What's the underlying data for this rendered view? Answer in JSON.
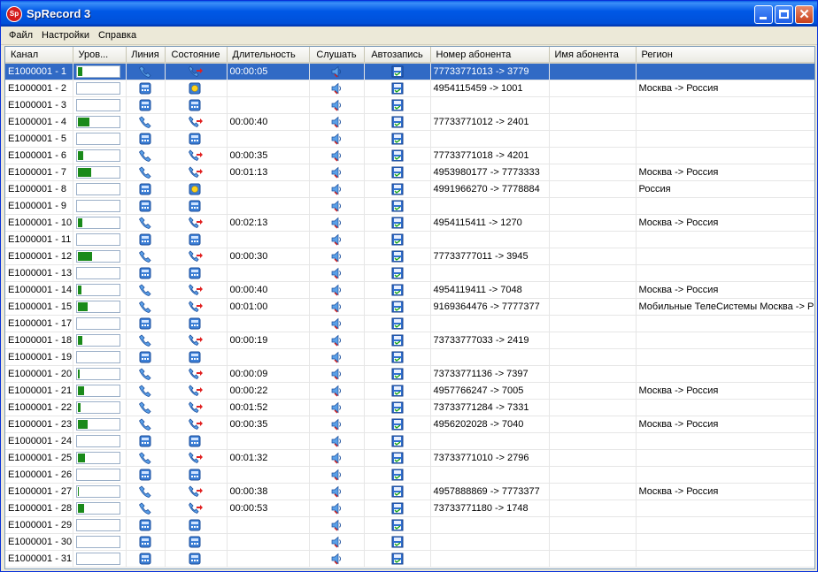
{
  "window": {
    "title": "SpRecord 3",
    "icon_label": "Sp"
  },
  "menu": [
    {
      "label": "Файл"
    },
    {
      "label": "Настройки"
    },
    {
      "label": "Справка"
    }
  ],
  "columns": [
    "Канал",
    "Уров...",
    "Линия",
    "Состояние",
    "Длительность",
    "Слушать",
    "Автозапись",
    "Номер абонента",
    "Имя абонента",
    "Регион"
  ],
  "icons": {
    "line_idle": "desk-phone-icon",
    "line_active": "handset-icon",
    "state_call": "handset-arrow-icon",
    "state_ring": "ringing-icon",
    "listen": "speaker-icon",
    "autorecord": "disk-record-icon"
  },
  "rows": [
    {
      "channel": "E1000001 - 1",
      "level": 0.12,
      "line": "active",
      "state": "call",
      "duration": "00:00:05",
      "number": "77733771013 -> 3779",
      "name": "",
      "region": ""
    },
    {
      "channel": "E1000001 - 2",
      "level": 0,
      "line": "idle",
      "state": "ring",
      "duration": "",
      "number": "4954115459 -> 1001",
      "name": "",
      "region": "Москва -> Россия"
    },
    {
      "channel": "E1000001 - 3",
      "level": 0,
      "line": "idle",
      "state": "idle",
      "duration": "",
      "number": "",
      "name": "",
      "region": ""
    },
    {
      "channel": "E1000001 - 4",
      "level": 0.28,
      "line": "active",
      "state": "call",
      "duration": "00:00:40",
      "number": "77733771012 -> 2401",
      "name": "",
      "region": ""
    },
    {
      "channel": "E1000001 - 5",
      "level": 0,
      "line": "idle",
      "state": "idle",
      "duration": "",
      "number": "",
      "name": "",
      "region": ""
    },
    {
      "channel": "E1000001 - 6",
      "level": 0.14,
      "line": "active",
      "state": "call",
      "duration": "00:00:35",
      "number": "77733771018 -> 4201",
      "name": "",
      "region": ""
    },
    {
      "channel": "E1000001 - 7",
      "level": 0.32,
      "line": "active",
      "state": "call",
      "duration": "00:01:13",
      "number": "4953980177 -> 7773333",
      "name": "",
      "region": "Москва -> Россия"
    },
    {
      "channel": "E1000001 - 8",
      "level": 0,
      "line": "idle",
      "state": "ring",
      "duration": "",
      "number": "4991966270 -> 7778884",
      "name": "",
      "region": "Россия"
    },
    {
      "channel": "E1000001 - 9",
      "level": 0,
      "line": "idle",
      "state": "idle",
      "duration": "",
      "number": "",
      "name": "",
      "region": ""
    },
    {
      "channel": "E1000001 - 10",
      "level": 0.12,
      "line": "active",
      "state": "call",
      "duration": "00:02:13",
      "number": "4954115411 -> 1270",
      "name": "",
      "region": "Москва -> Россия"
    },
    {
      "channel": "E1000001 - 11",
      "level": 0,
      "line": "idle",
      "state": "idle",
      "duration": "",
      "number": "",
      "name": "",
      "region": ""
    },
    {
      "channel": "E1000001 - 12",
      "level": 0.34,
      "line": "active",
      "state": "call",
      "duration": "00:00:30",
      "number": "77733777011 -> 3945",
      "name": "",
      "region": ""
    },
    {
      "channel": "E1000001 - 13",
      "level": 0,
      "line": "idle",
      "state": "idle",
      "duration": "",
      "number": "",
      "name": "",
      "region": ""
    },
    {
      "channel": "E1000001 - 14",
      "level": 0.1,
      "line": "active",
      "state": "call",
      "duration": "00:00:40",
      "number": "4954119411 -> 7048",
      "name": "",
      "region": "Москва -> Россия"
    },
    {
      "channel": "E1000001 - 15",
      "level": 0.24,
      "line": "active",
      "state": "call",
      "duration": "00:01:00",
      "number": "9169364476 -> 7777377",
      "name": "",
      "region": "Мобильные ТелеСистемы  Москва -> Р"
    },
    {
      "channel": "E1000001 - 17",
      "level": 0,
      "line": "idle",
      "state": "idle",
      "duration": "",
      "number": "",
      "name": "",
      "region": ""
    },
    {
      "channel": "E1000001 - 18",
      "level": 0.12,
      "line": "active",
      "state": "call",
      "duration": "00:00:19",
      "number": "73733777033 -> 2419",
      "name": "",
      "region": ""
    },
    {
      "channel": "E1000001 - 19",
      "level": 0,
      "line": "idle",
      "state": "idle",
      "duration": "",
      "number": "",
      "name": "",
      "region": ""
    },
    {
      "channel": "E1000001 - 20",
      "level": 0.05,
      "line": "active",
      "state": "call",
      "duration": "00:00:09",
      "number": "73733771136 -> 7397",
      "name": "",
      "region": ""
    },
    {
      "channel": "E1000001 - 21",
      "level": 0.16,
      "line": "active",
      "state": "call",
      "duration": "00:00:22",
      "number": "4957766247 -> 7005",
      "name": "",
      "region": "Москва -> Россия"
    },
    {
      "channel": "E1000001 - 22",
      "level": 0.08,
      "line": "active",
      "state": "call",
      "duration": "00:01:52",
      "number": "73733771284 -> 7331",
      "name": "",
      "region": ""
    },
    {
      "channel": "E1000001 - 23",
      "level": 0.24,
      "line": "active",
      "state": "call",
      "duration": "00:00:35",
      "number": "4956202028 -> 7040",
      "name": "",
      "region": "Москва -> Россия"
    },
    {
      "channel": "E1000001 - 24",
      "level": 0,
      "line": "idle",
      "state": "idle",
      "duration": "",
      "number": "",
      "name": "",
      "region": ""
    },
    {
      "channel": "E1000001 - 25",
      "level": 0.18,
      "line": "active",
      "state": "call",
      "duration": "00:01:32",
      "number": "73733771010 -> 2796",
      "name": "",
      "region": ""
    },
    {
      "channel": "E1000001 - 26",
      "level": 0,
      "line": "idle",
      "state": "idle",
      "duration": "",
      "number": "",
      "name": "",
      "region": ""
    },
    {
      "channel": "E1000001 - 27",
      "level": 0.04,
      "line": "active",
      "state": "call",
      "duration": "00:00:38",
      "number": "4957888869 -> 7773377",
      "name": "",
      "region": "Москва -> Россия"
    },
    {
      "channel": "E1000001 - 28",
      "level": 0.16,
      "line": "active",
      "state": "call",
      "duration": "00:00:53",
      "number": "73733771180 -> 1748",
      "name": "",
      "region": ""
    },
    {
      "channel": "E1000001 - 29",
      "level": 0,
      "line": "idle",
      "state": "idle",
      "duration": "",
      "number": "",
      "name": "",
      "region": ""
    },
    {
      "channel": "E1000001 - 30",
      "level": 0,
      "line": "idle",
      "state": "idle",
      "duration": "",
      "number": "",
      "name": "",
      "region": ""
    },
    {
      "channel": "E1000001 - 31",
      "level": 0,
      "line": "idle",
      "state": "idle",
      "duration": "",
      "number": "",
      "name": "",
      "region": ""
    }
  ],
  "selected_row": 0,
  "colors": {
    "selection": "#316ac5",
    "level_fill": "#1a8a1a",
    "title_bar": "#0058e6"
  }
}
